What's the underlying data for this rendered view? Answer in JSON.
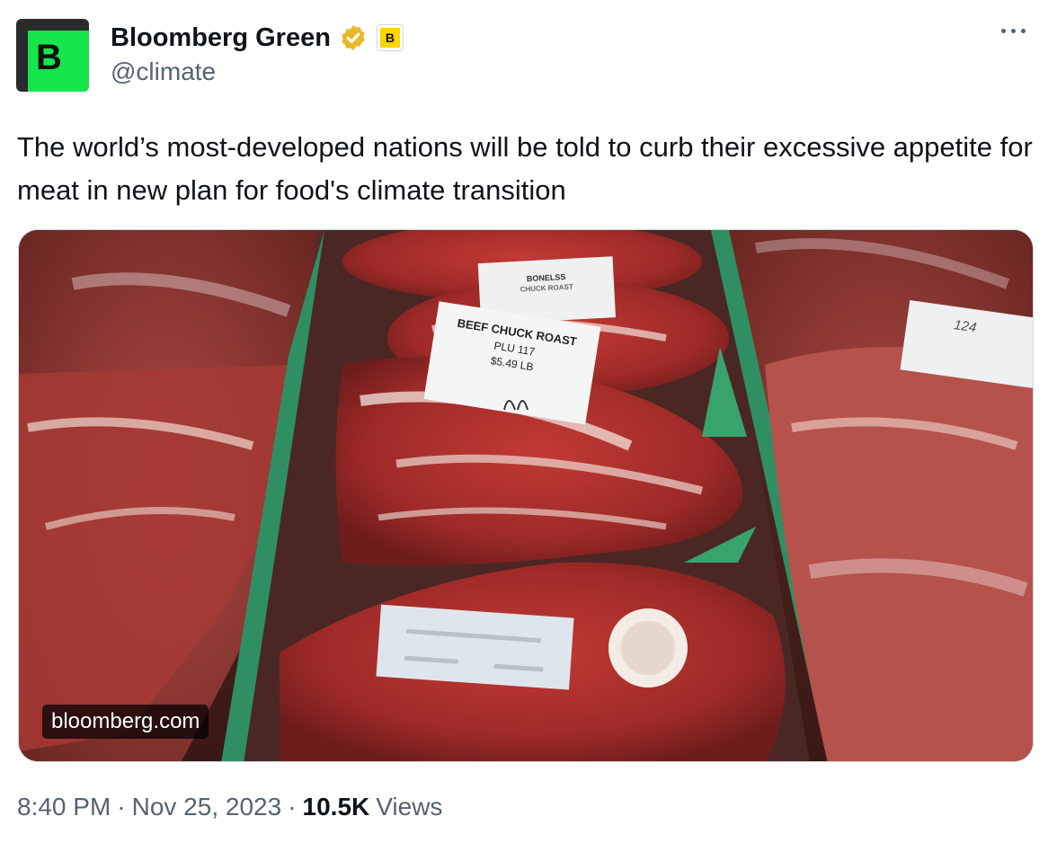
{
  "author": {
    "avatar_letter": "B",
    "name": "Bloomberg Green",
    "handle": "@climate",
    "affiliate_letter": "B",
    "verified_color": "#e8b829",
    "avatar_color": "#15e64a"
  },
  "tweet": {
    "text": "The world’s most-developed nations will be told to curb their excessive appetite for meat in new plan for food's climate transition"
  },
  "media": {
    "link_domain": "bloomberg.com",
    "labels": {
      "top": [
        "BONELSS",
        "CHUCK ROAST"
      ],
      "main": [
        "BEEF CHUCK ROAST",
        "PLU 117",
        "$5.49 LB"
      ],
      "right": "124"
    }
  },
  "meta": {
    "time": "8:40 PM",
    "date": "Nov 25, 2023",
    "views_count": "10.5K",
    "views_label": "Views",
    "separator": "·"
  }
}
